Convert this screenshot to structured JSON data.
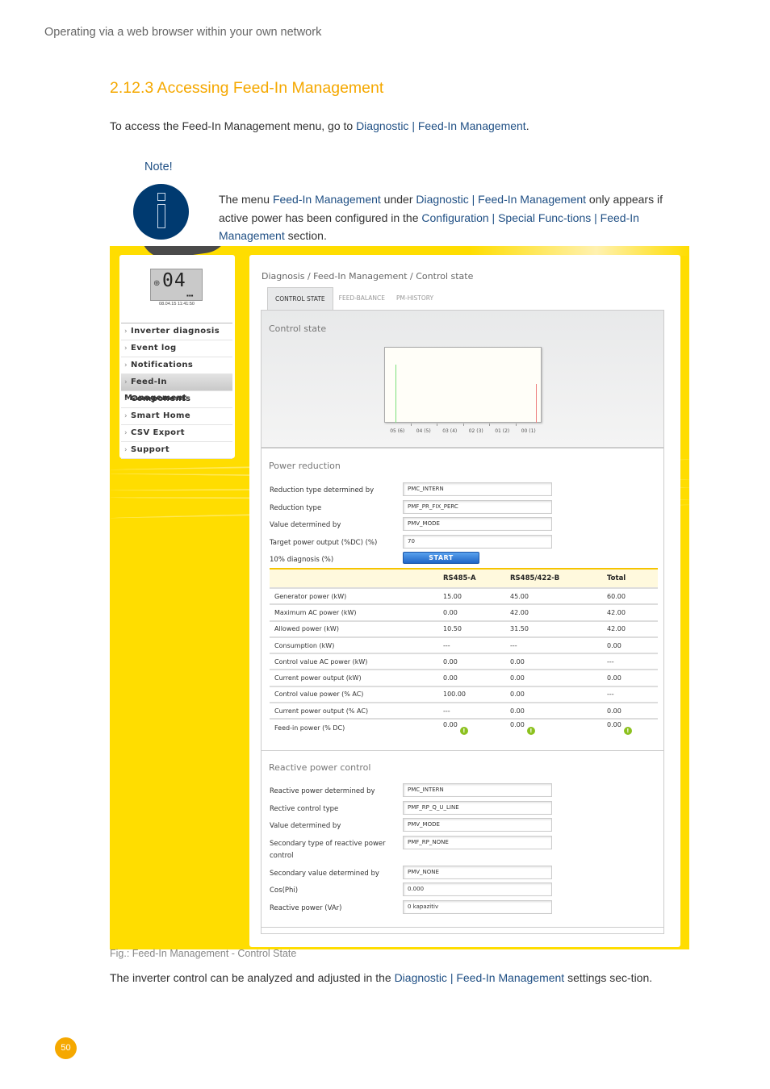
{
  "header": {
    "running_title": "Operating via a web browser within your own network"
  },
  "section": {
    "title": "2.12.3 Accessing Feed-In Management",
    "intro_prefix": "To access the Feed-In Management menu, go to ",
    "intro_link": "Diagnostic | Feed-In Management",
    "intro_suffix": "."
  },
  "note": {
    "label": "Note!",
    "icon": "info-icon",
    "parts": [
      {
        "text": "The menu ",
        "link": false
      },
      {
        "text": "Feed-In Management",
        "link": true
      },
      {
        "text": " under ",
        "link": false
      },
      {
        "text": "Diagnostic | Feed-In Management",
        "link": true
      },
      {
        "text": " only appears if active power has been configured in the ",
        "link": false
      },
      {
        "text": "Configuration | Special Func-tions | Feed-In Management",
        "link": true
      },
      {
        "text": " section.",
        "link": false
      }
    ]
  },
  "screenshot": {
    "lcd": {
      "digits": "04",
      "timestamp": "08.04.15 11:41:50",
      "icon": "globe-icon"
    },
    "sidebar": {
      "items": [
        {
          "label": "Inverter diagnosis",
          "active": false
        },
        {
          "label": "Event log",
          "active": false
        },
        {
          "label": "Notifications",
          "active": false
        },
        {
          "label": "Feed-In Management",
          "active": true
        },
        {
          "label": "Components",
          "active": false
        },
        {
          "label": "Smart Home",
          "active": false
        },
        {
          "label": "CSV Export",
          "active": false
        },
        {
          "label": "Support",
          "active": false
        }
      ]
    },
    "breadcrumb": "Diagnosis / Feed-In Management / Control state",
    "tabs": [
      {
        "label": "CONTROL STATE",
        "active": true
      },
      {
        "label": "FEED-BALANCE",
        "active": false
      },
      {
        "label": "PM-HISTORY",
        "active": false
      }
    ],
    "control_state": {
      "title": "Control state"
    },
    "power_reduction": {
      "title": "Power reduction",
      "fields": [
        {
          "label": "Reduction type determined by",
          "value": "PMC_INTERN"
        },
        {
          "label": "Reduction type",
          "value": "PMF_PR_FIX_PERC"
        },
        {
          "label": "Value determined by",
          "value": "PMV_MODE"
        },
        {
          "label": "Target power output (%DC) (%)",
          "value": "70"
        }
      ],
      "diagnosis_label": "10% diagnosis (%)",
      "start_button": "START"
    },
    "table": {
      "headers": [
        "",
        "RS485-A",
        "RS485/422-B",
        "Total"
      ],
      "rows": [
        [
          "Generator power (kW)",
          "15.00",
          "45.00",
          "60.00"
        ],
        [
          "Maximum AC power (kW)",
          "0.00",
          "42.00",
          "42.00"
        ],
        [
          "Allowed power (kW)",
          "10.50",
          "31.50",
          "42.00"
        ],
        [
          "Consumption (kW)",
          "---",
          "---",
          "0.00"
        ],
        [
          "Control value AC power (kW)",
          "0.00",
          "0.00",
          "---"
        ],
        [
          "Current power output (kW)",
          "0.00",
          "0.00",
          "0.00"
        ],
        [
          "Control value power (% AC)",
          "100.00",
          "0.00",
          "---"
        ],
        [
          "Current power output (% AC)",
          "---",
          "0.00",
          "0.00"
        ],
        [
          "Feed-in power (% DC)",
          "0.00",
          "0.00",
          "0.00"
        ]
      ],
      "warning_icon": "exclamation-circle-icon",
      "warning_color": "#8cc11f"
    },
    "reactive_power": {
      "title": "Reactive power control",
      "fields": [
        {
          "label": "Reactive power determined by",
          "value": "PMC_INTERN"
        },
        {
          "label": "Rective control type",
          "value": "PMF_RP_Q_U_LINE"
        },
        {
          "label": "Value determined by",
          "value": "PMV_MODE"
        },
        {
          "label": "Secondary type of reactive power control",
          "value": "PMF_RP_NONE"
        },
        {
          "label": "Secondary value determined by",
          "value": "PMV_NONE"
        },
        {
          "label": "Cos(Phi)",
          "value": "0.000"
        },
        {
          "label": "Reactive power (VAr)",
          "value": "0 kapazitiv"
        }
      ]
    }
  },
  "chart_data": {
    "type": "bar",
    "title": "Control state",
    "categories": [
      "05 (6)",
      "04 (5)",
      "03 (4)",
      "02 (3)",
      "01 (2)",
      "00 (1)"
    ],
    "series": [
      {
        "name": "green",
        "color": "#7be07b",
        "values": [
          0.77,
          null,
          null,
          null,
          null,
          null
        ]
      },
      {
        "name": "red",
        "color": "#ee7d7d",
        "values": [
          null,
          null,
          null,
          null,
          null,
          0.51
        ]
      }
    ],
    "ylim": [
      0,
      1
    ],
    "xlabel": "",
    "ylabel": "",
    "grid": false
  },
  "caption": "Fig.: Feed-In Management - Control State",
  "outro": {
    "prefix": "The inverter control can be analyzed and adjusted in the ",
    "link": "Diagnostic | Feed-In Management",
    "suffix": " settings sec-tion."
  },
  "page_number": "50",
  "colors": {
    "accent": "#f5a800",
    "link": "#1f4f84",
    "note_icon": "#003a70",
    "figure_bg": "#ffdd00"
  }
}
